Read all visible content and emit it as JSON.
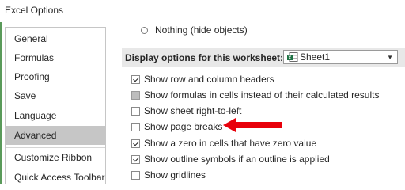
{
  "window": {
    "title": "Excel Options"
  },
  "sidebar": {
    "items": [
      {
        "label": "General",
        "active": false
      },
      {
        "label": "Formulas",
        "active": false
      },
      {
        "label": "Proofing",
        "active": false
      },
      {
        "label": "Save",
        "active": false
      },
      {
        "label": "Language",
        "active": false
      },
      {
        "label": "Advanced",
        "active": true
      },
      {
        "label": "Customize Ribbon",
        "active": false
      },
      {
        "label": "Quick Access Toolbar",
        "active": false
      }
    ]
  },
  "main": {
    "radio_nothing": {
      "label": "Nothing (hide objects)",
      "selected": false
    },
    "worksheet_section": {
      "label": "Display options for this worksheet:",
      "selected_sheet": "Sheet1",
      "sheet_icon": "excel-sheet-icon"
    },
    "options": [
      {
        "label": "Show row and column headers",
        "checked": true,
        "disabled": false
      },
      {
        "label": "Show formulas in cells instead of their calculated results",
        "checked": false,
        "disabled": true
      },
      {
        "label": "Show sheet right-to-left",
        "checked": false,
        "disabled": false
      },
      {
        "label": "Show page breaks",
        "checked": false,
        "disabled": false
      },
      {
        "label": "Show a zero in cells that have zero value",
        "checked": true,
        "disabled": false
      },
      {
        "label": "Show outline symbols if an outline is applied",
        "checked": true,
        "disabled": false
      },
      {
        "label": "Show gridlines",
        "checked": false,
        "disabled": false
      }
    ],
    "annotation": {
      "icon": "red-arrow-icon",
      "color": "#e8000b"
    }
  }
}
